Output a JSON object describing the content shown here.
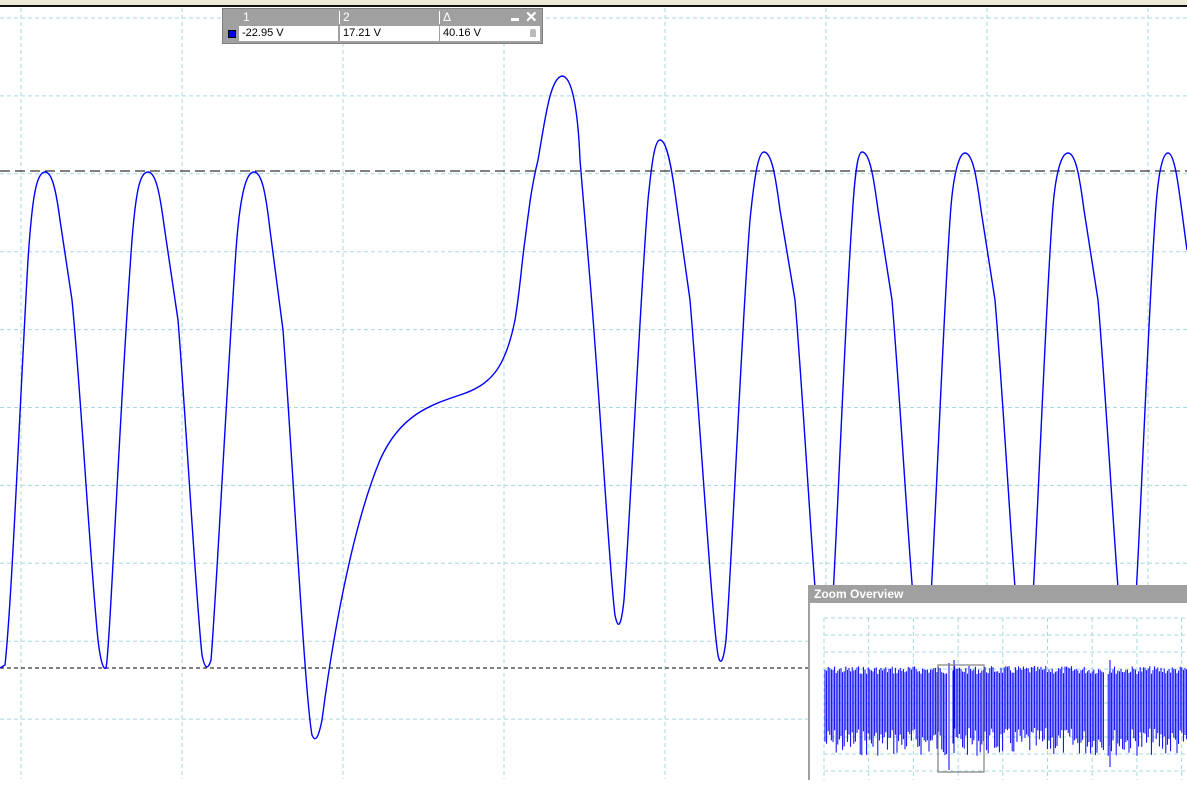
{
  "ruler_panel": {
    "headers": [
      "1",
      "2",
      "Δ"
    ],
    "values": [
      "-22.95 V",
      "17.21 V",
      "40.16 V"
    ],
    "minimize_icon": "minimize-icon",
    "close_icon": "close-icon",
    "lock_icon": "lock-icon",
    "channel_color": "#0000ff"
  },
  "overview": {
    "title": "Zoom Overview"
  },
  "colors": {
    "trace": "#0000ff",
    "grid": "#a8d8e0"
  }
}
